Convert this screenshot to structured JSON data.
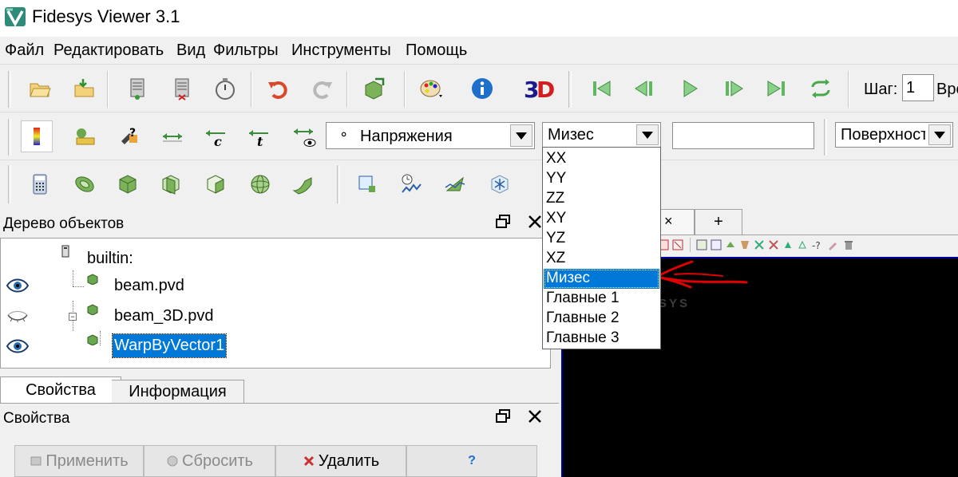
{
  "window": {
    "title": "Fidesys Viewer 3.1"
  },
  "menu": [
    "Файл",
    "Редактировать",
    "Вид",
    "Фильтры",
    "Инструменты",
    "Помощь"
  ],
  "toolbar1": {
    "step_label": "Шаг:",
    "step_value": "1",
    "time_label_partial": "Вре"
  },
  "toolbar2": {
    "variable_combo": {
      "icon": "point-data-icon",
      "value": "Напряжения"
    },
    "component_combo": {
      "value": "Мизес"
    },
    "representation_combo": {
      "value": "Поверхност"
    }
  },
  "component_dropdown": {
    "items": [
      "XX",
      "YY",
      "ZZ",
      "XY",
      "YZ",
      "XZ",
      "Мизес",
      "Главные 1",
      "Главные 2",
      "Главные 3"
    ],
    "selected_index": 6
  },
  "pipeline": {
    "title": "Дерево объектов",
    "items": [
      {
        "label": "builtin:",
        "visible": null
      },
      {
        "label": "beam.pvd",
        "visible": true
      },
      {
        "label": "beam_3D.pvd",
        "visible": false
      },
      {
        "label": "WarpByVector1",
        "visible": true,
        "selected": true
      }
    ]
  },
  "view_tabs": {
    "close_glyph": "×",
    "add_label": "+"
  },
  "viewport": {
    "watermark": "SYS"
  },
  "properties": {
    "tabs": [
      "Свойства",
      "Информация"
    ],
    "panel_title": "Свойства",
    "buttons": {
      "apply": "Применить",
      "reset": "Сбросить",
      "delete": "Удалить",
      "help": "?"
    }
  },
  "colors": {
    "selection": "#0078d7",
    "annotation_red": "#e00000",
    "viewport_bg": "#000000"
  }
}
